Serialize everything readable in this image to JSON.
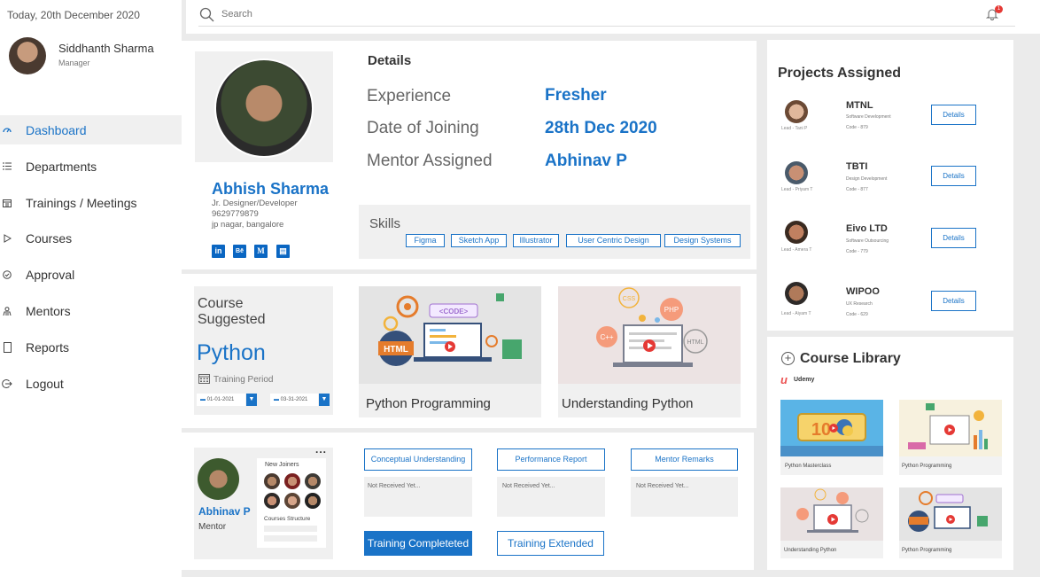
{
  "sidebar": {
    "date": "Today, 20th December 2020",
    "user_name": "Siddhanth Sharma",
    "user_role": "Manager",
    "items": [
      {
        "label": "Dashboard",
        "icon": "dashboard-icon",
        "active": true
      },
      {
        "label": "Departments",
        "icon": "list-icon"
      },
      {
        "label": "Trainings / Meetings",
        "icon": "calendar-icon"
      },
      {
        "label": "Courses",
        "icon": "play-icon"
      },
      {
        "label": "Approval",
        "icon": "check-circle-icon"
      },
      {
        "label": "Mentors",
        "icon": "person-icon"
      },
      {
        "label": "Reports",
        "icon": "document-icon"
      },
      {
        "label": "Logout",
        "icon": "logout-icon"
      }
    ]
  },
  "header": {
    "search_placeholder": "Search",
    "notification_count": "1"
  },
  "profile": {
    "name": "Abhish Sharma",
    "title": "Jr. Designer/Developer",
    "phone": "9629779879",
    "location": "jp nagar, bangalore",
    "social": [
      "in",
      "Bē",
      "M",
      "▤"
    ]
  },
  "details": {
    "title": "Details",
    "rows": [
      {
        "label": "Experience",
        "value": "Fresher"
      },
      {
        "label": "Date of Joining",
        "value": "28th Dec 2020"
      },
      {
        "label": "Mentor Assigned",
        "value": "Abhinav P"
      }
    ],
    "skills_label": "Skills",
    "skills": [
      "Figma",
      "Sketch App",
      "Illustrator",
      "User Centric Design",
      "Design Systems"
    ]
  },
  "course_suggested": {
    "label": "Course Suggested",
    "course": "Python",
    "training_period_label": "Training Period",
    "start_date": "01-01-2021",
    "end_date": "03-31-2021"
  },
  "course_cards": [
    {
      "title": "Python Programming",
      "tag": "<CODE>",
      "badge": "HTML"
    },
    {
      "title": "Understanding Python",
      "bubbles": [
        "CSS",
        "PHP",
        "C++",
        "HTML"
      ]
    }
  ],
  "mentor": {
    "name": "Abhinav P",
    "role": "Mentor",
    "new_joiners_label": "New Joiners",
    "courses_structure_label": "Courses Structure",
    "more": "..."
  },
  "feedback": {
    "tabs": [
      "Conceptual Understanding",
      "Performance Report",
      "Mentor Remarks"
    ],
    "status": [
      "Not Received Yet...",
      "Not Received Yet...",
      "Not Received Yet..."
    ],
    "btn_completed": "Training Completeted",
    "btn_extended": "Training Extended"
  },
  "projects": {
    "title": "Projects Assigned",
    "details_label": "Details",
    "items": [
      {
        "name": "MTNL",
        "type": "Software Development",
        "code": "Code - 879",
        "lead": "Lead - Tani P"
      },
      {
        "name": "TBTI",
        "type": "Design Development",
        "code": "Code - 877",
        "lead": "Lead - Priyam T"
      },
      {
        "name": "Eivo LTD",
        "type": "Software Outsourcing",
        "code": "Code - 779",
        "lead": "Lead - Amera T"
      },
      {
        "name": "WIPOO",
        "type": "UX Research",
        "code": "Code - 629",
        "lead": "Lead - Aiyam T"
      }
    ]
  },
  "library": {
    "title": "Course Library",
    "provider": "Udemy",
    "items": [
      {
        "caption": "Python Masterclass",
        "badge": "10"
      },
      {
        "caption": "Python Programming"
      },
      {
        "caption": "Understanding Python"
      },
      {
        "caption": "Python Programming"
      }
    ]
  },
  "colors": {
    "accent": "#1a73c7",
    "alert": "#e53935",
    "udemy": "#ec5252"
  }
}
